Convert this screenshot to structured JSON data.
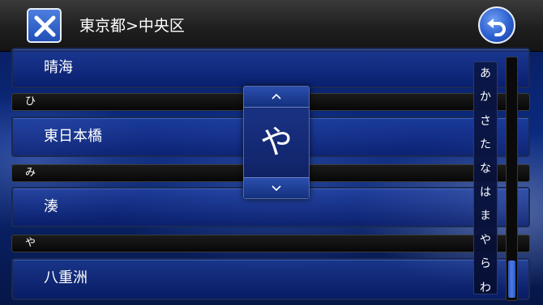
{
  "header": {
    "title": "東京都>中央区",
    "close_icon": "close-x-icon",
    "back_icon": "back-arrow-icon",
    "accent": "#2a5fd0"
  },
  "list": {
    "rows": [
      {
        "label": "晴海"
      },
      {
        "section": "ひ"
      },
      {
        "label": "東日本橋"
      },
      {
        "section": "み"
      },
      {
        "label": "湊"
      },
      {
        "section": "や"
      },
      {
        "label": "八重洲"
      }
    ]
  },
  "popup": {
    "letter": "や",
    "up_icon": "chevron-up-icon",
    "down_icon": "chevron-down-icon"
  },
  "kana_index": [
    "あ",
    "か",
    "さ",
    "た",
    "な",
    "は",
    "ま",
    "や",
    "ら",
    "わ"
  ]
}
